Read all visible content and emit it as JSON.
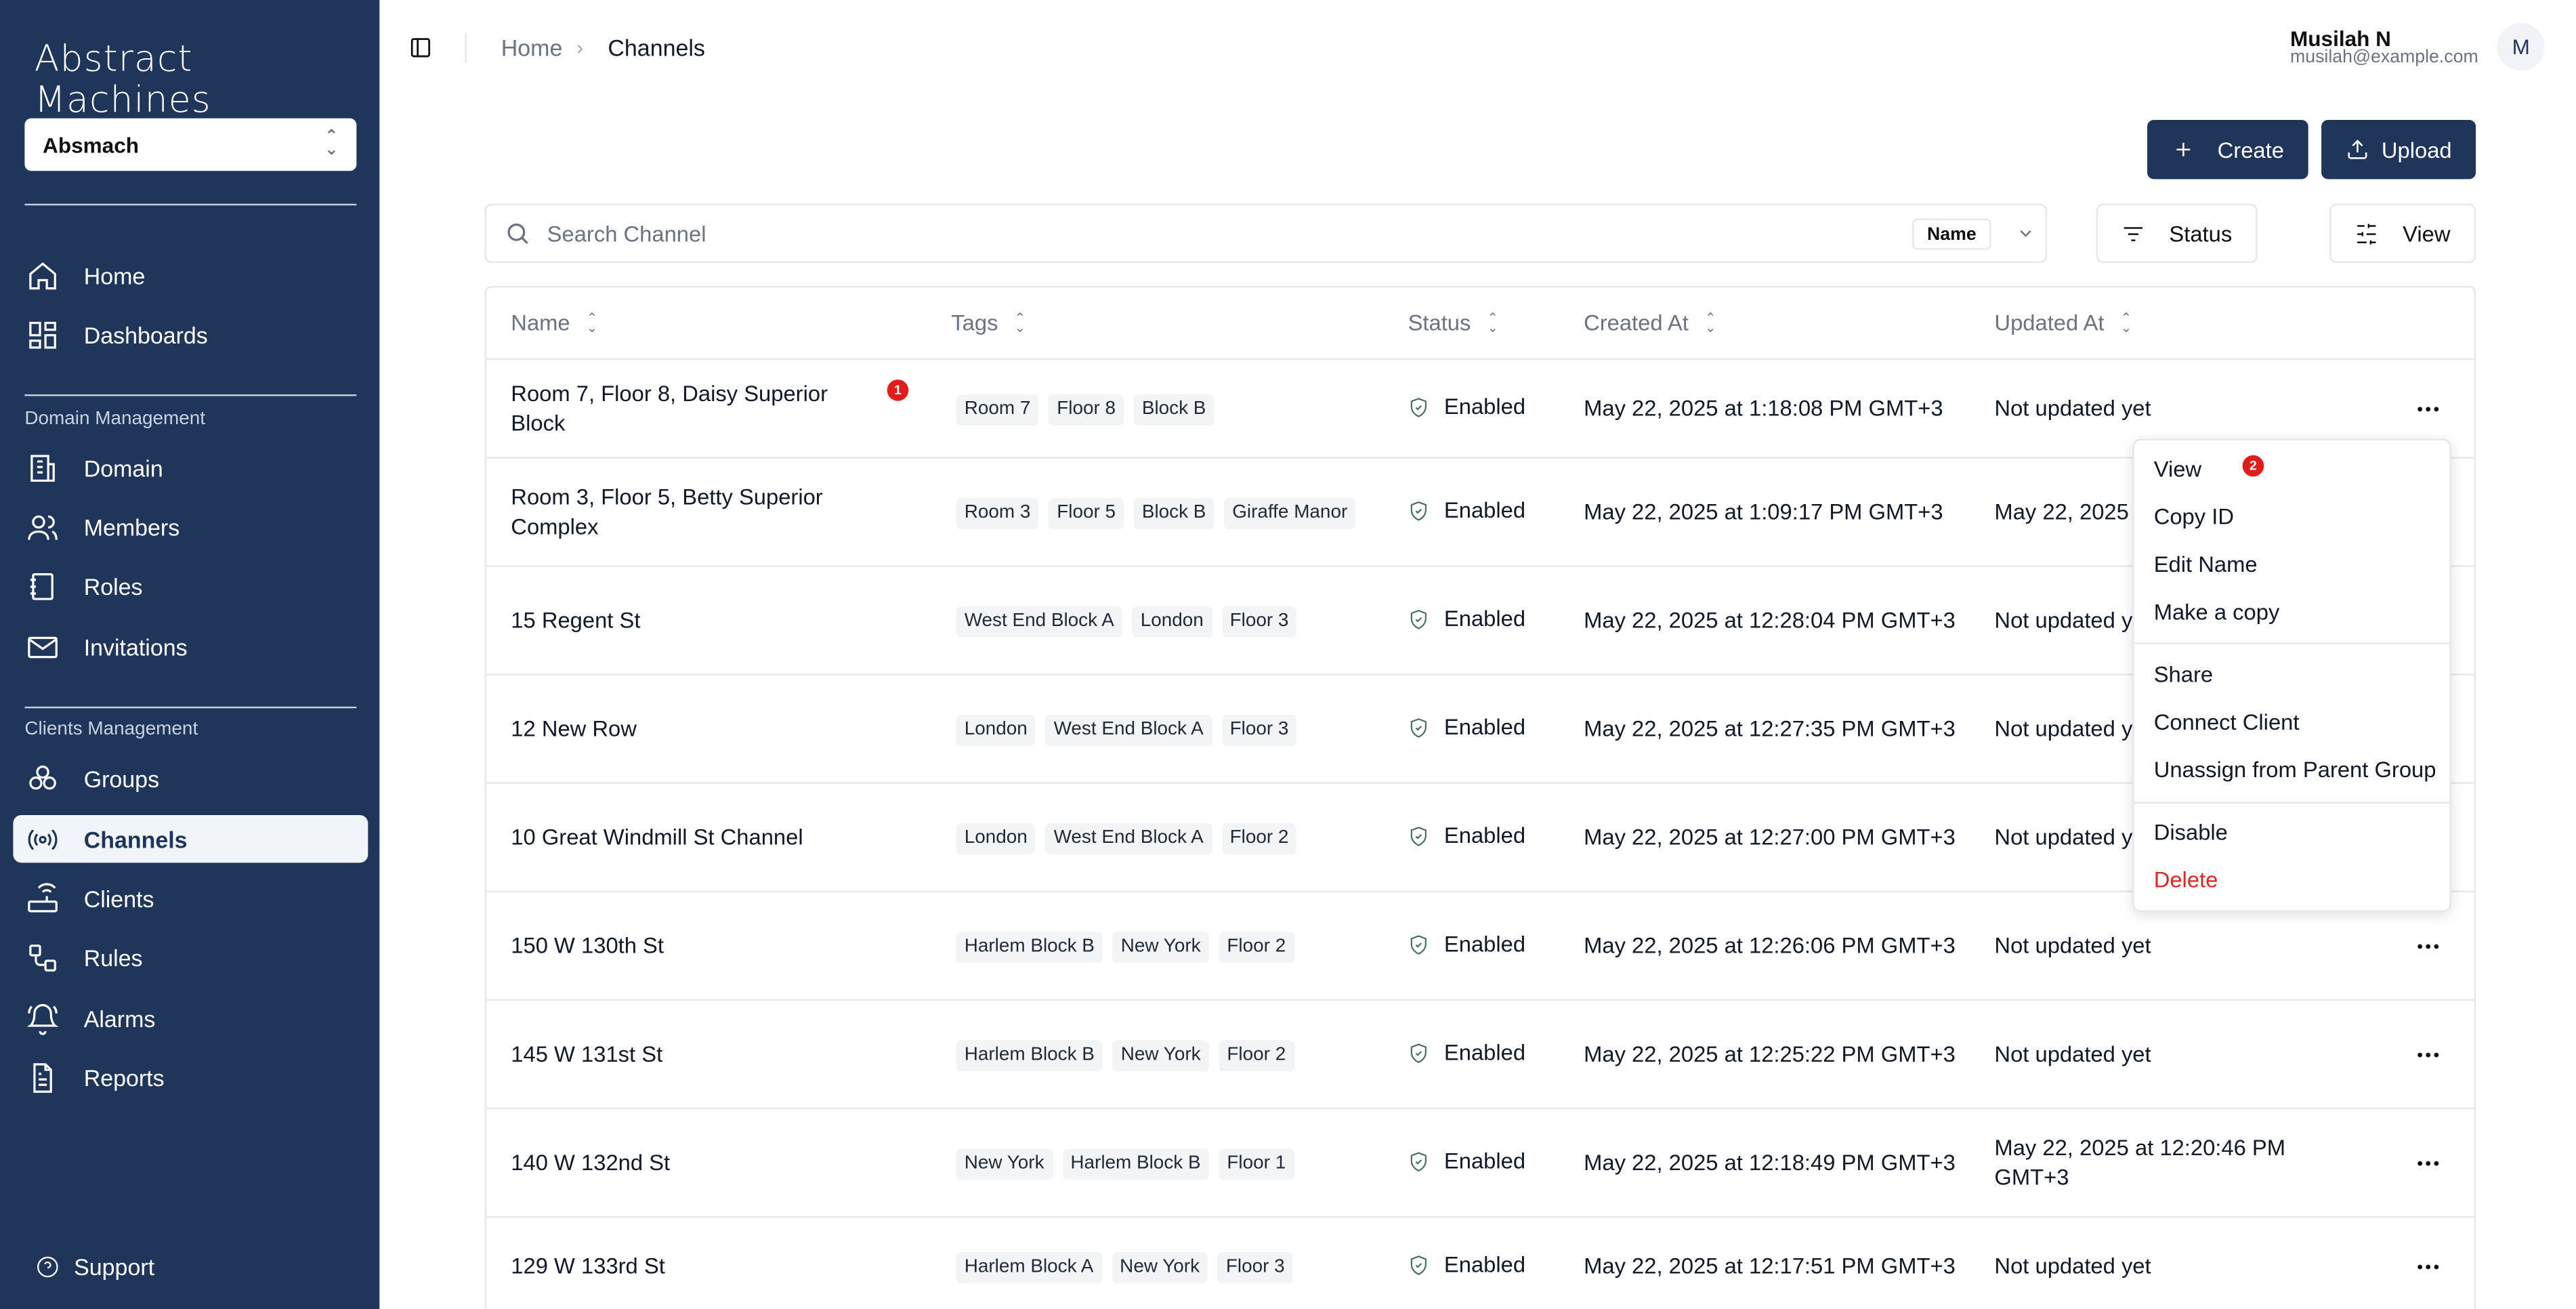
{
  "app": {
    "logo": "Abstract Machines",
    "org": "Absmach"
  },
  "sidebar": {
    "top_items": [
      {
        "label": "Home",
        "icon": "home-icon"
      },
      {
        "label": "Dashboards",
        "icon": "dashboard-icon"
      }
    ],
    "domain_section": "Domain Management",
    "domain_items": [
      {
        "label": "Domain",
        "icon": "building-icon"
      },
      {
        "label": "Members",
        "icon": "users-icon"
      },
      {
        "label": "Roles",
        "icon": "notebook-icon"
      },
      {
        "label": "Invitations",
        "icon": "mail-icon"
      }
    ],
    "clients_section": "Clients Management",
    "clients_items": [
      {
        "label": "Groups",
        "icon": "groups-icon"
      },
      {
        "label": "Channels",
        "icon": "radio-icon",
        "active": true
      },
      {
        "label": "Clients",
        "icon": "router-icon"
      },
      {
        "label": "Rules",
        "icon": "workflow-icon"
      },
      {
        "label": "Alarms",
        "icon": "bell-ring-icon"
      },
      {
        "label": "Reports",
        "icon": "file-text-icon"
      }
    ],
    "support": "Support"
  },
  "header": {
    "breadcrumb": {
      "home": "Home",
      "separator": "›",
      "current": "Channels"
    },
    "user": {
      "name": "Musilah N",
      "email": "musilah@example.com",
      "initial": "M"
    }
  },
  "toolbar": {
    "create": "Create",
    "upload": "Upload",
    "search_placeholder": "Search Channel",
    "search_field": "Name",
    "status": "Status",
    "view": "View"
  },
  "table": {
    "columns": [
      "Name",
      "Tags",
      "Status",
      "Created At",
      "Updated At"
    ],
    "rows": [
      {
        "name": "Room 7, Floor 8, Daisy Superior Block",
        "tags": [
          "Room 7",
          "Floor 8",
          "Block B"
        ],
        "status": "Enabled",
        "created": "May 22, 2025 at 1:18:08 PM GMT+3",
        "updated": "Not updated yet"
      },
      {
        "name": "Room 3, Floor 5, Betty Superior Complex",
        "tags": [
          "Room 3",
          "Floor 5",
          "Block B",
          "Giraffe Manor"
        ],
        "status": "Enabled",
        "created": "May 22, 2025 at 1:09:17 PM GMT+3",
        "updated": "May 22, 2025"
      },
      {
        "name": "15 Regent St",
        "tags": [
          "West End Block A",
          "London",
          "Floor 3"
        ],
        "status": "Enabled",
        "created": "May 22, 2025 at 12:28:04 PM GMT+3",
        "updated": "Not updated yet"
      },
      {
        "name": "12 New Row",
        "tags": [
          "London",
          "West End Block A",
          "Floor 3"
        ],
        "status": "Enabled",
        "created": "May 22, 2025 at 12:27:35 PM GMT+3",
        "updated": "Not updated yet"
      },
      {
        "name": "10 Great Windmill St Channel",
        "tags": [
          "London",
          "West End Block A",
          "Floor 2"
        ],
        "status": "Enabled",
        "created": "May 22, 2025 at 12:27:00 PM GMT+3",
        "updated": "Not updated yet"
      },
      {
        "name": "150 W 130th St",
        "tags": [
          "Harlem Block B",
          "New York",
          "Floor 2"
        ],
        "status": "Enabled",
        "created": "May 22, 2025 at 12:26:06 PM GMT+3",
        "updated": "Not updated yet"
      },
      {
        "name": "145 W 131st St",
        "tags": [
          "Harlem Block B",
          "New York",
          "Floor 2"
        ],
        "status": "Enabled",
        "created": "May 22, 2025 at 12:25:22 PM GMT+3",
        "updated": "Not updated yet"
      },
      {
        "name": "140 W 132nd St",
        "tags": [
          "New York",
          "Harlem Block B",
          "Floor 1"
        ],
        "status": "Enabled",
        "created": "May 22, 2025 at 12:18:49 PM GMT+3",
        "updated": "May 22, 2025 at 12:20:46 PM GMT+3"
      },
      {
        "name": "129 W 133rd St",
        "tags": [
          "Harlem Block A",
          "New York",
          "Floor 3"
        ],
        "status": "Enabled",
        "created": "May 22, 2025 at 12:17:51 PM GMT+3",
        "updated": "Not updated yet"
      }
    ]
  },
  "badges": {
    "row_badge": "1",
    "menu_badge": "2"
  },
  "context_menu": {
    "items": [
      "View",
      "Copy ID",
      "Edit Name",
      "Make a copy",
      "Share",
      "Connect Client",
      "Unassign from Parent Group",
      "Disable",
      "Delete"
    ]
  },
  "colors": {
    "sidebar_bg": "#1f355a",
    "primary": "#1f355a",
    "danger": "#dc2626",
    "badge": "#e21b1b"
  }
}
